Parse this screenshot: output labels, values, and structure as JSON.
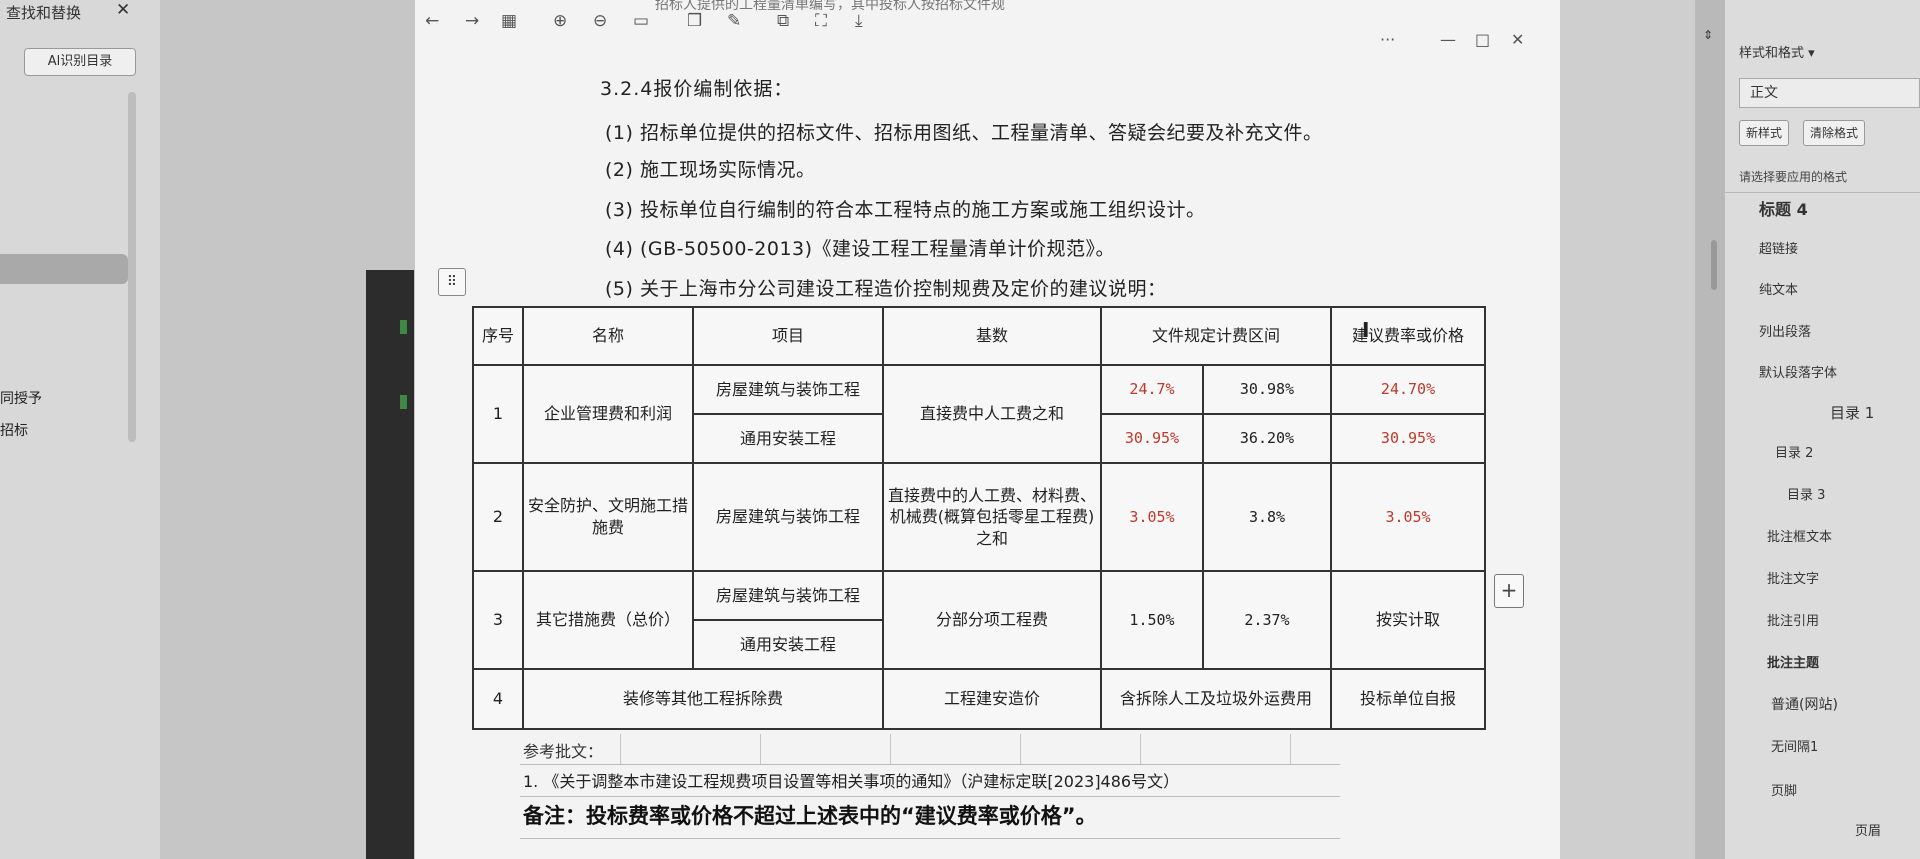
{
  "find_panel": {
    "title": "查找和替换",
    "close": "✕",
    "ai_button": "Al识别目录",
    "snippets": [
      "同授予",
      "招标"
    ]
  },
  "toolbar": {
    "back": "←",
    "forward": "→",
    "grid": "▦",
    "zoom_in": "⊕",
    "zoom_out": "⊖",
    "fit": "▭",
    "hint_text": "招标人提供的工程量清单编写，其中投标人按招标文件规"
  },
  "window": {
    "more": "···",
    "minimize": "—",
    "maximize": "□",
    "close": "✕"
  },
  "document": {
    "heading": "3.2.4报价编制依据：",
    "paragraphs": [
      "(1) 招标单位提供的招标文件、招标用图纸、工程量清单、答疑会纪要及补充文件。",
      "(2) 施工现场实际情况。",
      "(3) 投标单位自行编制的符合本工程特点的施工方案或施工组织设计。",
      "(4) (GB-50500-2013)《建设工程工程量清单计价规范》。",
      "(5) 关于上海市分公司建设工程造价控制规费及定价的建议说明："
    ],
    "table": {
      "headers": [
        "序号",
        "名称",
        "项目",
        "基数",
        "文件规定计费区间",
        "建议费率或价格"
      ],
      "rows": [
        {
          "no": "1",
          "name": "企业管理费和利润",
          "items": [
            "房屋建筑与装饰工程",
            "通用安装工程"
          ],
          "base": "直接费中人工费之和",
          "ranges": [
            [
              "24.7%",
              "30.98%"
            ],
            [
              "30.95%",
              "36.20%"
            ]
          ],
          "suggest": [
            "24.70%",
            "30.95%"
          ]
        },
        {
          "no": "2",
          "name": "安全防护、文明施工措施费",
          "items": [
            "房屋建筑与装饰工程"
          ],
          "base": "直接费中的人工费、材料费、机械费(概算包括零星工程费)之和",
          "ranges": [
            [
              "3.05%",
              "3.8%"
            ]
          ],
          "suggest": [
            "3.05%"
          ]
        },
        {
          "no": "3",
          "name": "其它措施费（总价）",
          "items": [
            "房屋建筑与装饰工程",
            "通用安装工程"
          ],
          "base": "分部分项工程费",
          "ranges": [
            [
              "1.50%",
              "2.37%"
            ]
          ],
          "suggest": [
            "按实计取"
          ]
        },
        {
          "no": "4",
          "name": "装修等其他工程拆除费",
          "base": "工程建安造价",
          "range_text": "含拆除人工及垃圾外运费用",
          "suggest": [
            "投标单位自报"
          ]
        }
      ]
    },
    "ref_label": "参考批文：",
    "ref_item": "1. 《关于调整本市建设工程规费项目设置等相关事项的通知》（沪建标定联[2023]486号文）",
    "remark": "备注：投标费率或价格不超过上述表中的“建议费率或价格”。"
  },
  "styles_panel": {
    "title": "样式和格式 ▾",
    "current": "正文",
    "new_style": "新样式",
    "clear_format": "清除格式",
    "hint": "请选择要应用的格式",
    "items": [
      "标题 4",
      "超链接",
      "纯文本",
      "列出段落",
      "默认段落字体",
      "目录 1",
      "目录 2",
      "目录 3",
      "批注框文本",
      "批注文字",
      "批注引用",
      "批注主题",
      "普通(网站)",
      "无间隔1",
      "页脚",
      "页眉"
    ]
  },
  "colors": {
    "accent_red": "#c0392b"
  }
}
